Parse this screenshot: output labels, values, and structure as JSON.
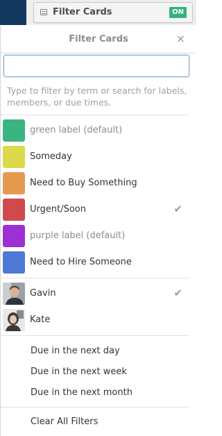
{
  "topbar": {
    "filter_button_label": "Filter Cards",
    "status_badge": "ON"
  },
  "panel": {
    "title": "Filter Cards",
    "close_symbol": "×",
    "search": {
      "value": "",
      "placeholder": ""
    },
    "hint": "Type to filter by term or search for labels, members, or due times.",
    "labels": [
      {
        "name": "green label (default)",
        "color": "#3bb57f",
        "muted": true,
        "checked": false
      },
      {
        "name": "Someday",
        "color": "#dcd94a",
        "muted": false,
        "checked": false
      },
      {
        "name": "Need to Buy Something",
        "color": "#e59a4e",
        "muted": false,
        "checked": false
      },
      {
        "name": "Urgent/Soon",
        "color": "#d04a4d",
        "muted": false,
        "checked": true
      },
      {
        "name": "purple label (default)",
        "color": "#9e2fd3",
        "muted": true,
        "checked": false
      },
      {
        "name": "Need to Hire Someone",
        "color": "#4f78d6",
        "muted": false,
        "checked": false
      }
    ],
    "members": [
      {
        "name": "Gavin",
        "checked": true
      },
      {
        "name": "Kate",
        "checked": false
      }
    ],
    "due": [
      "Due in the next day",
      "Due in the next week",
      "Due in the next month"
    ],
    "clear": "Clear All Filters",
    "check_symbol": "✔"
  }
}
